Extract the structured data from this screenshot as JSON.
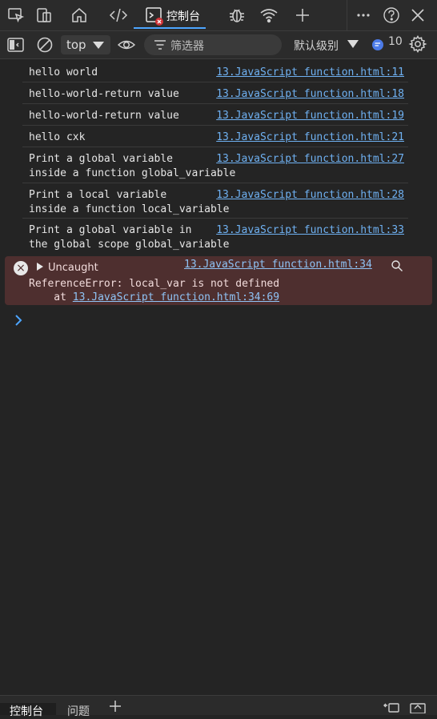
{
  "top_tabs": {
    "console_label": "控制台"
  },
  "toolbar": {
    "context": "top",
    "filter_placeholder": "筛选器",
    "level_label": "默认级别",
    "message_count": "10"
  },
  "logs": [
    {
      "message": "hello world",
      "source": "13.JavaScript function.html:11"
    },
    {
      "message": "hello-world-return value",
      "source": "13.JavaScript function.html:18"
    },
    {
      "message": "hello-world-return value",
      "source": "13.JavaScript function.html:19"
    },
    {
      "message": "hello cxk",
      "source": "13.JavaScript function.html:21"
    },
    {
      "message": "Print a global variable\ninside a function global_variable",
      "source": "13.JavaScript function.html:27"
    },
    {
      "message": "Print a local variable\ninside a function local_variable",
      "source": "13.JavaScript function.html:28"
    },
    {
      "message": "Print a global variable in\nthe global scope global_variable",
      "source": "13.JavaScript function.html:33"
    }
  ],
  "error": {
    "label": "Uncaught",
    "source": "13.JavaScript function.html:34",
    "message": "ReferenceError: local_var is not defined",
    "at_prefix": "    at ",
    "at_link": "13.JavaScript function.html:34:69"
  },
  "bottom_tabs": {
    "console_label": "控制台",
    "issues_label": "问题"
  }
}
